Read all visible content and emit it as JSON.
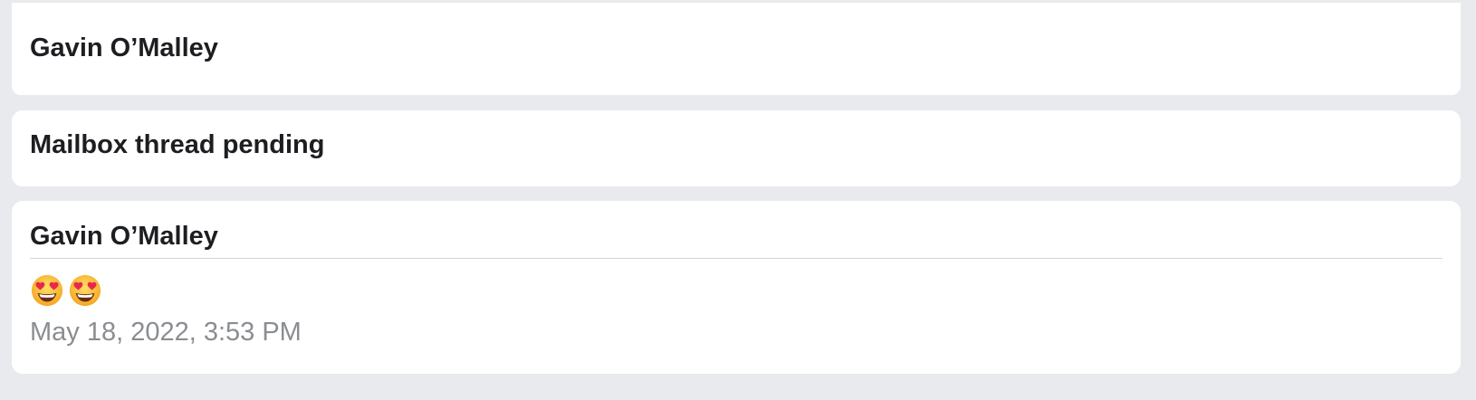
{
  "messages": [
    {
      "sender": "Gavin O’Malley"
    },
    {
      "subject": "Mailbox thread pending"
    },
    {
      "sender": "Gavin O’Malley",
      "body_emojis": [
        "heart-eyes-emoji-icon",
        "heart-eyes-emoji-icon"
      ],
      "timestamp": "May 18, 2022, 3:53 PM"
    }
  ],
  "colors": {
    "background": "#e9eaee",
    "card": "#ffffff",
    "text_primary": "#1c1e21",
    "text_secondary": "#8a8d91",
    "divider": "#d3d5da"
  }
}
